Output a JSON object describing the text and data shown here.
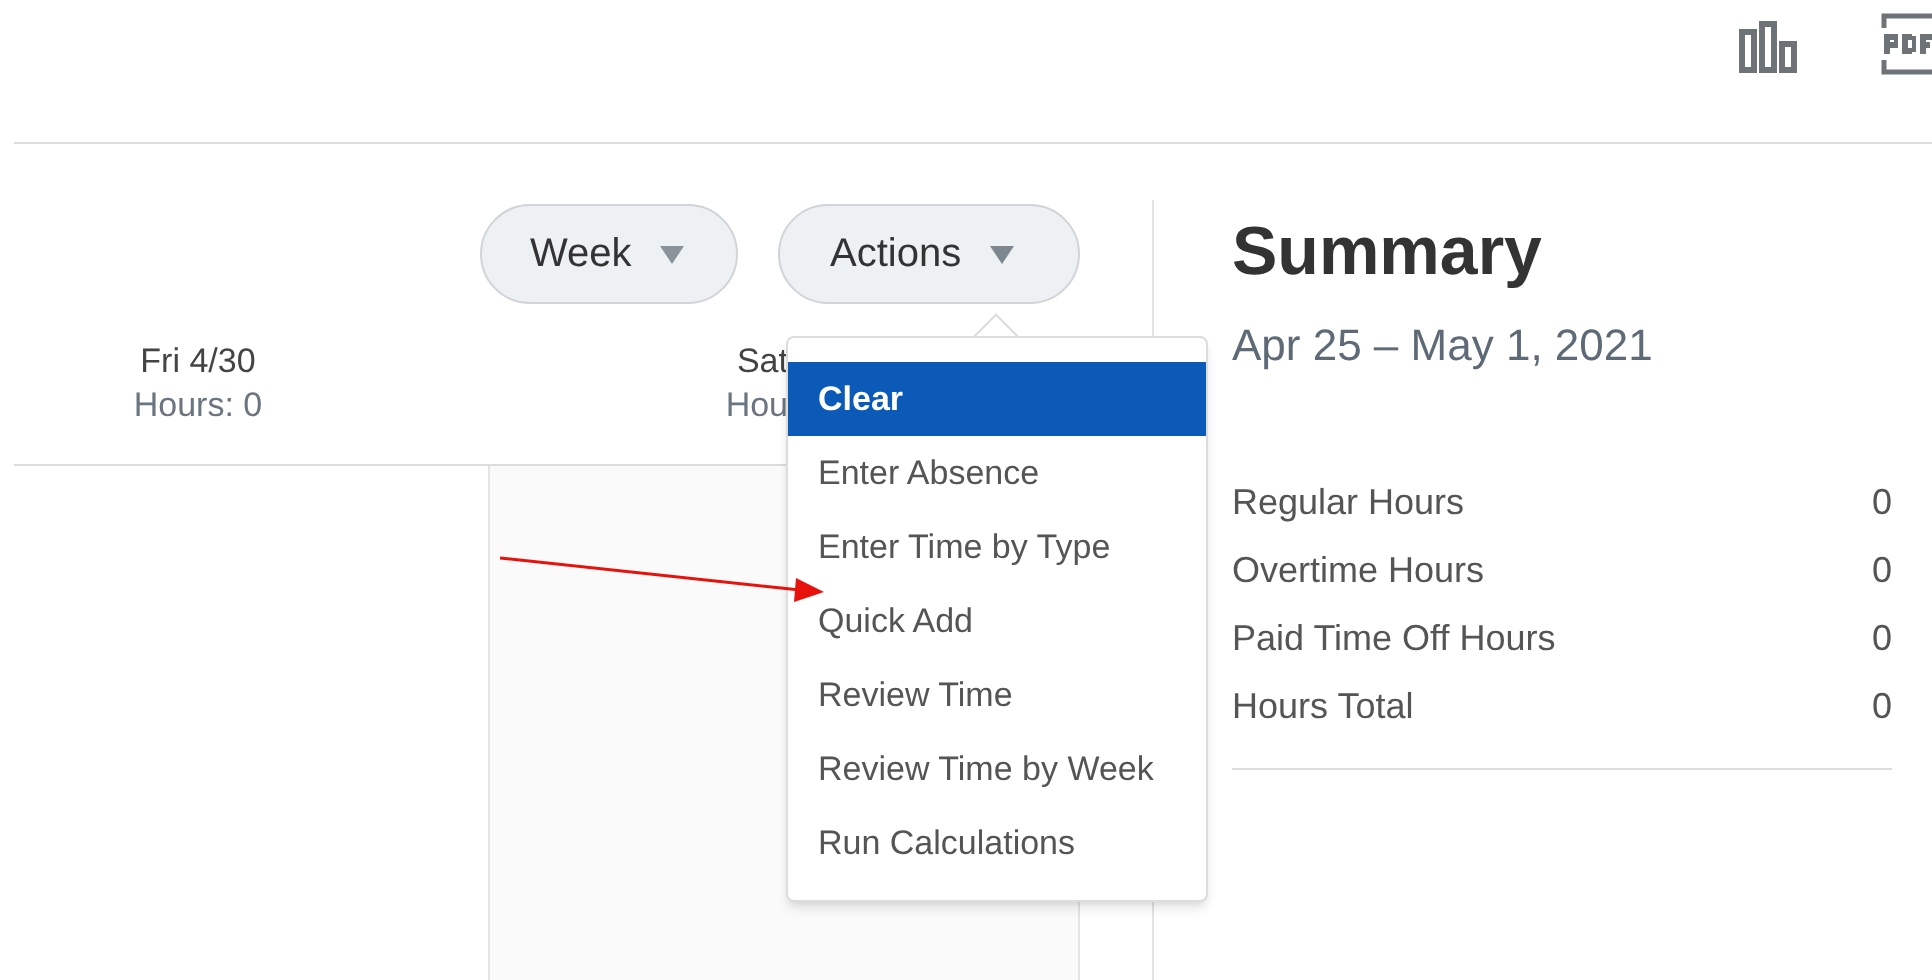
{
  "toolbar": {
    "buttons": [
      {
        "label": "Week",
        "expanded": false
      },
      {
        "label": "Actions",
        "expanded": true
      }
    ]
  },
  "days": [
    {
      "day": "Fri 4/30",
      "hours": "Hours: 0"
    },
    {
      "day": "Sat",
      "hours": "Hou"
    }
  ],
  "actions_menu": [
    {
      "label": "Clear",
      "selected": true
    },
    {
      "label": "Enter Absence",
      "selected": false
    },
    {
      "label": "Enter Time by Type",
      "selected": false
    },
    {
      "label": "Quick Add",
      "selected": false
    },
    {
      "label": "Review Time",
      "selected": false
    },
    {
      "label": "Review Time by Week",
      "selected": false
    },
    {
      "label": "Run Calculations",
      "selected": false
    }
  ],
  "summary": {
    "title": "Summary",
    "period": "Apr 25 – May 1, 2021",
    "rows": [
      {
        "label": "Regular Hours",
        "value": "0"
      },
      {
        "label": "Overtime Hours",
        "value": "0"
      },
      {
        "label": "Paid Time Off Hours",
        "value": "0"
      },
      {
        "label": "Hours Total",
        "value": "0"
      }
    ]
  }
}
